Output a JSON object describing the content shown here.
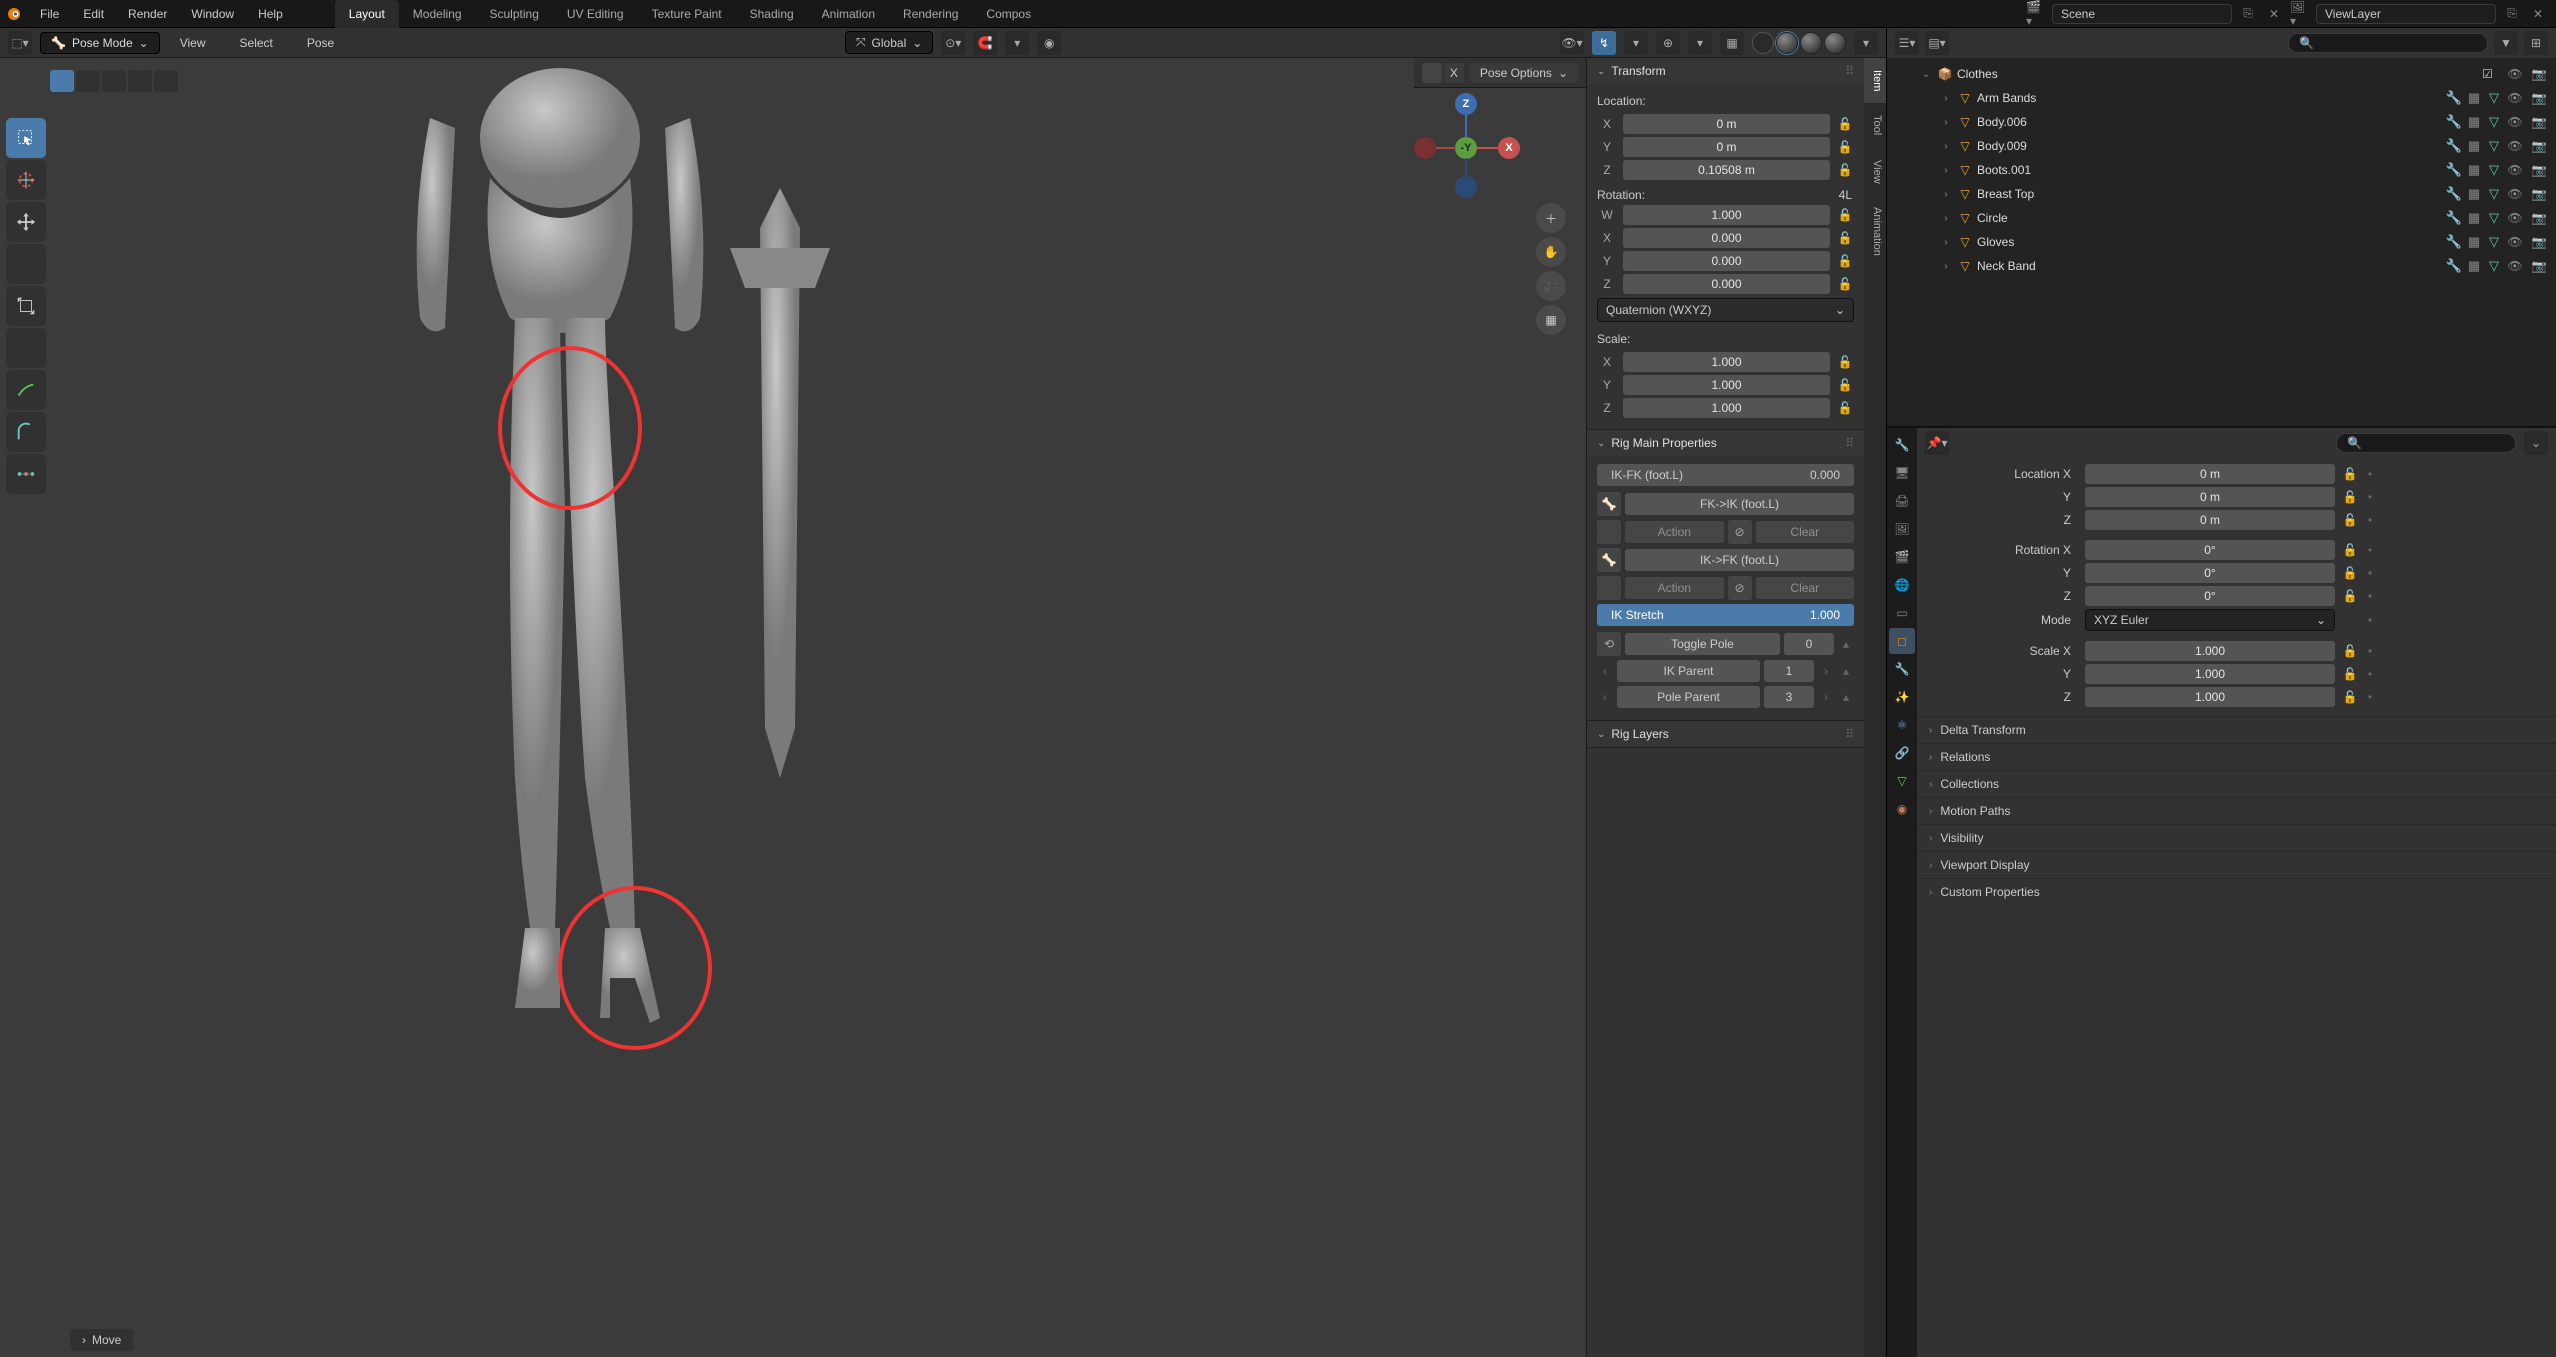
{
  "topmenu": [
    "File",
    "Edit",
    "Render",
    "Window",
    "Help"
  ],
  "workspaces": [
    "Layout",
    "Modeling",
    "Sculpting",
    "UV Editing",
    "Texture Paint",
    "Shading",
    "Animation",
    "Rendering",
    "Compos"
  ],
  "scene": {
    "name": "Scene"
  },
  "viewlayer": {
    "name": "ViewLayer"
  },
  "mode": {
    "label": "Pose Mode"
  },
  "viewmenus": [
    "View",
    "Select",
    "Pose"
  ],
  "orient": {
    "label": "Global"
  },
  "pose_options": {
    "label": "Pose Options"
  },
  "npanel_tabs": [
    "Item",
    "Tool",
    "View",
    "Animation"
  ],
  "transform": {
    "title": "Transform",
    "loc_label": "Location:",
    "loc": [
      {
        "k": "X",
        "v": "0 m"
      },
      {
        "k": "Y",
        "v": "0 m"
      },
      {
        "k": "Z",
        "v": "0.10508 m"
      }
    ],
    "rot_label": "Rotation:",
    "rot_mode_badge": "4L",
    "rot": [
      {
        "k": "W",
        "v": "1.000"
      },
      {
        "k": "X",
        "v": "0.000"
      },
      {
        "k": "Y",
        "v": "0.000"
      },
      {
        "k": "Z",
        "v": "0.000"
      }
    ],
    "rot_mode": "Quaternion (WXYZ)",
    "scale_label": "Scale:",
    "scale": [
      {
        "k": "X",
        "v": "1.000"
      },
      {
        "k": "Y",
        "v": "1.000"
      },
      {
        "k": "Z",
        "v": "1.000"
      }
    ]
  },
  "rig": {
    "title": "Rig Main Properties",
    "ikfk": {
      "label": "IK-FK (foot.L)",
      "value": "0.000"
    },
    "fk2ik": "FK->IK (foot.L)",
    "ik2fk": "IK->FK (foot.L)",
    "action": "Action",
    "clear": "Clear",
    "stretch": {
      "label": "IK Stretch",
      "value": "1.000"
    },
    "togglepole": {
      "label": "Toggle Pole",
      "value": "0"
    },
    "ikparent": {
      "label": "IK Parent",
      "value": "1"
    },
    "poleparent": {
      "label": "Pole Parent",
      "value": "3"
    },
    "layers_title": "Rig Layers"
  },
  "status": {
    "label": "Move"
  },
  "outliner": {
    "collection": "Clothes",
    "items": [
      {
        "name": "Arm Bands"
      },
      {
        "name": "Body.006"
      },
      {
        "name": "Body.009"
      },
      {
        "name": "Boots.001"
      },
      {
        "name": "Breast Top"
      },
      {
        "name": "Circle"
      },
      {
        "name": "Gloves"
      },
      {
        "name": "Neck Band"
      }
    ]
  },
  "props": {
    "loc_label": "Location X",
    "loc": [
      "0 m",
      "0 m",
      "0 m"
    ],
    "rot_label": "Rotation X",
    "rot": [
      "0°",
      "0°",
      "0°"
    ],
    "mode_label": "Mode",
    "mode": "XYZ Euler",
    "scale_label": "Scale X",
    "scale": [
      "1.000",
      "1.000",
      "1.000"
    ],
    "yz": [
      "Y",
      "Z"
    ],
    "sections": [
      "Delta Transform",
      "Relations",
      "Collections",
      "Motion Paths",
      "Visibility",
      "Viewport Display",
      "Custom Properties"
    ]
  },
  "search_ph": "",
  "axis": {
    "x": "X",
    "y": "-Y",
    "z": "Z"
  }
}
